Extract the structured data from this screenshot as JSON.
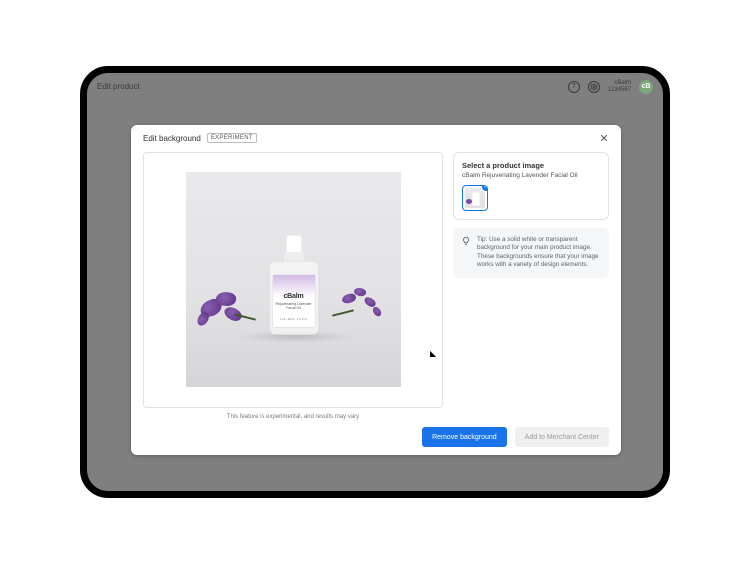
{
  "app": {
    "title": "Edit product",
    "account_line1": "cBalm",
    "account_line2": "1234567",
    "avatar_initials": "cB"
  },
  "modal": {
    "title": "Edit background",
    "badge": "EXPERIMENT",
    "disclaimer": "This feature is experimental, and results may vary",
    "product_brand": "cBalm",
    "product_label_sub": "Rejuvenating\nLavender Facial Oil",
    "product_label_vol": "1 oz / 30ml · 1.0 fl oz"
  },
  "side": {
    "select_title": "Select a product image",
    "product_name": "cBalm Rejuvenating Lavender Facial Oil",
    "tip": "Tip: Use a solid white or transparent background for your main product image. These backgrounds ensure that your image works with a variety of design elements."
  },
  "actions": {
    "primary": "Remove background",
    "secondary": "Add to Merchant Center"
  }
}
